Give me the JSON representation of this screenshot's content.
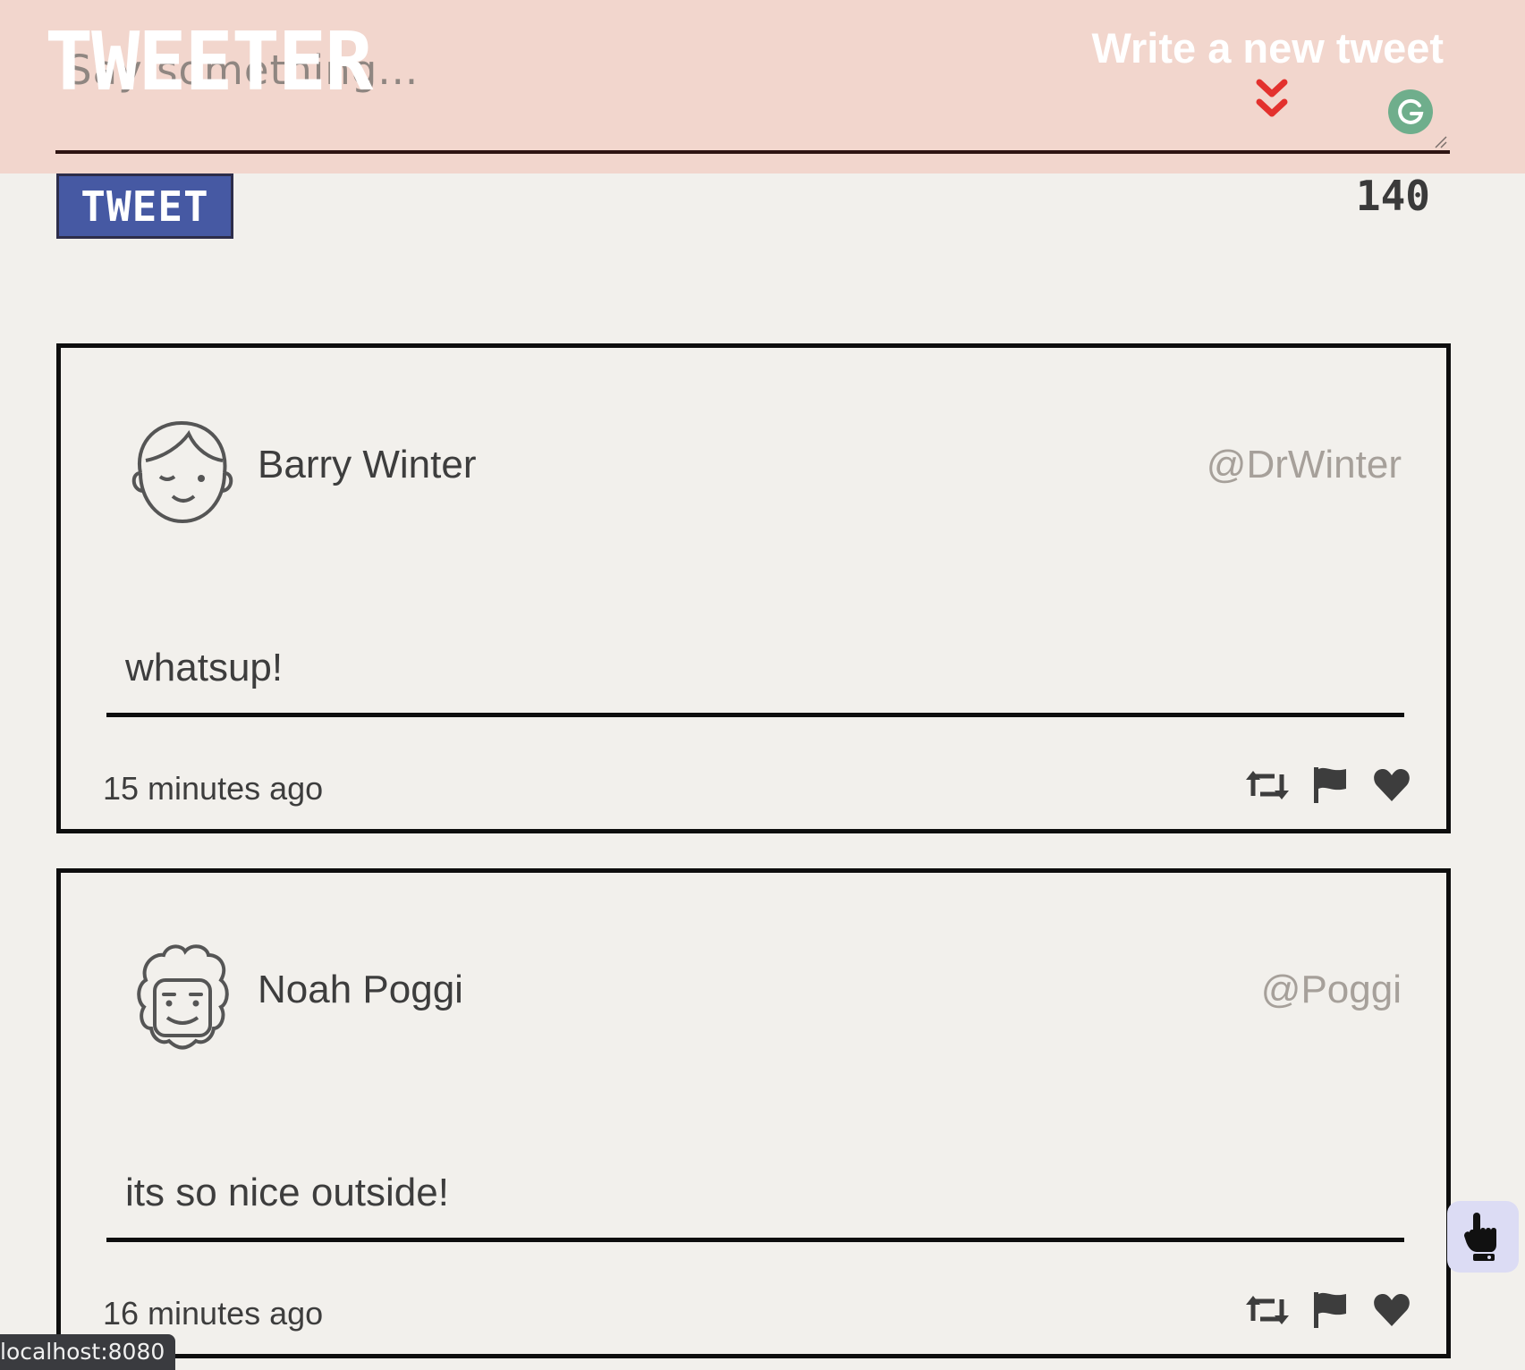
{
  "header": {
    "brand": "TWEETER",
    "write_link": "Write a new tweet"
  },
  "compose": {
    "placeholder": "Say something...",
    "button_label": "TWEET",
    "char_count": "140"
  },
  "tweets": [
    {
      "name": "Barry Winter",
      "handle": "@DrWinter",
      "text": "whatsup!",
      "time": "15 minutes ago"
    },
    {
      "name": "Noah Poggi",
      "handle": "@Poggi",
      "text": "its so nice outside!",
      "time": "16 minutes ago"
    }
  ],
  "status_bar": {
    "url": "localhost:8080"
  },
  "icons": {
    "chevrons": "double-chevron-down-icon",
    "grammarly": "grammarly-icon",
    "retweet": "retweet-icon",
    "flag": "flag-icon",
    "like": "heart-icon",
    "floating": "hand-pointer-icon"
  },
  "colors": {
    "header_bg": "#f2d6cd",
    "page_bg": "#f2f0ec",
    "tweet_button_bg": "#4659a3",
    "chevron_red": "#e3312d",
    "grammarly_green": "#6fae8c",
    "handle_gray": "#a6a09a"
  }
}
